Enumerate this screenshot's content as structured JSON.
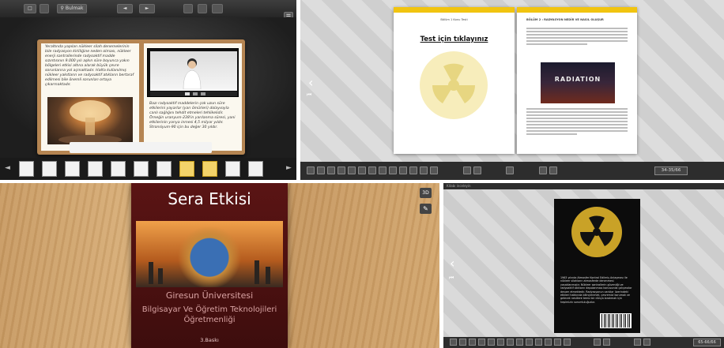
{
  "panel1": {
    "toolbar": {
      "zoom_label": "Bulmak",
      "btn_a": "□",
      "btn_b": "◄",
      "btn_c": "►"
    },
    "left_text": "Yeraltında yapılan nükleer silah denemelerinin bile radyasyon kirliliğine neden olması, nükleer enerji santrallerinde radyoaktif madde sızıntısının 9.000 yılı aşkın süre boyunca yakın bölgeleri etkisi altına alarak büyük çevre sorunlarına yol açmaktadır. Hatta kullanılmış nükleer yakıtların ve radyoaktif atıkların bertaraf edilmesi bile önemli sorunları ortaya çıkarmaktadır.",
    "right_text": "Bazı radyoaktif maddelerin çok uzun süre etkilerini yayarlar (yarı ömürleri) dolayısıyla canlı sağlığını tehdit etmeleri tehlikelidir. Örneğin uranyum-238'in yarılanma süresi, yani etkilerinin yarıya inmesi 4,5 milyar yıldır. Stronsiyum-90 için bu değer 30 yıldır.",
    "thumb_count": 11,
    "selected_thumbs": [
      7,
      8
    ]
  },
  "panel2": {
    "left_header": "Bölüm 1 Konu Testi",
    "test_link": "Test için tıklayınız",
    "right_header": "BÖLÜM 2 : RADYASYON NEDİR VE NASIL OLUŞUR",
    "poster_title": "RADIATION",
    "page_indicator": "34-35/66"
  },
  "panel3": {
    "title": "Sera Etkisi",
    "university": "Giresun Üniversitesi",
    "department_line1": "Bilgisayar Ve Öğretim Teknolojileri",
    "department_line2": "Öğretmenliği",
    "edition": "3.Baskı",
    "btn_3d": "3D",
    "btn_pen": "✎"
  },
  "panel4": {
    "top_label": "Kitabı inceleyin",
    "back_text": "1963 yılında Atmosfer Kontrol Edilmiş Anlaşması ile nükleer silahların atmosferde denenmesi yasaklanmıştır. Nükleer santrallerin güvenliği ve radyoaktif atıkların depolanması konusunda çalışmalar devam etmektedir. Radyasyonun canlılar üzerindeki etkileri hakkında bilinçlenmek, çevremizi korumak ve gelecek nesillere temiz bir dünya bırakmak için hepimizin sorumluluğudur.",
    "page_indicator": "65-66/66"
  }
}
